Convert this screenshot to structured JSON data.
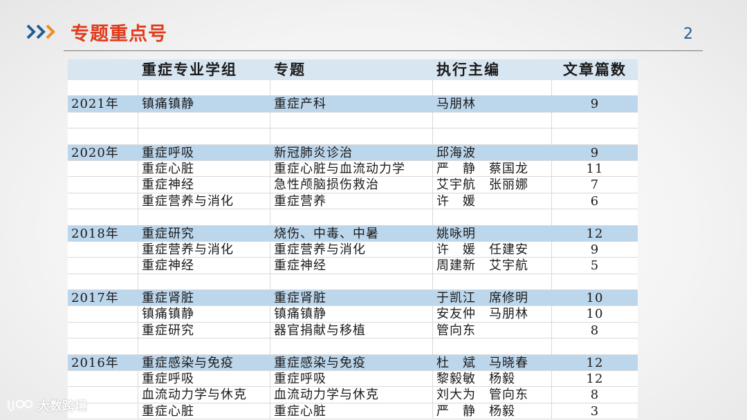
{
  "slide": {
    "title": "专题重点号",
    "page_number": "2"
  },
  "colors": {
    "title": "#e03b1c",
    "chevron_blue": "#1f5d97",
    "chevron_orange": "#f08a24",
    "header_row": "#d8e6f2",
    "year_row": "#bcd6ec"
  },
  "table": {
    "headers": [
      "",
      "重症专业学组",
      "专题",
      "执行主编",
      "文章篇数"
    ],
    "rows": [
      {
        "type": "blank",
        "cells": [
          "",
          "",
          "",
          "",
          ""
        ]
      },
      {
        "type": "year",
        "cells": [
          "2021年",
          "镇痛镇静",
          "重症产科",
          "马朋林",
          "9"
        ]
      },
      {
        "type": "blank",
        "cells": [
          "",
          "",
          "",
          "",
          ""
        ]
      },
      {
        "type": "blank",
        "cells": [
          "",
          "",
          "",
          "",
          ""
        ]
      },
      {
        "type": "year",
        "cells": [
          "2020年",
          "重症呼吸",
          "新冠肺炎诊治",
          "邱海波",
          "9"
        ]
      },
      {
        "type": "data",
        "cells": [
          "",
          "重症心脏",
          "重症心脏与血流动力学",
          "严　静　蔡国龙",
          "11"
        ]
      },
      {
        "type": "data",
        "cells": [
          "",
          "重症神经",
          "急性颅脑损伤救治",
          "艾宇航　张丽娜",
          "7"
        ]
      },
      {
        "type": "data",
        "cells": [
          "",
          "重症营养与消化",
          "重症营养",
          "许　媛",
          "6"
        ]
      },
      {
        "type": "blank",
        "cells": [
          "",
          "",
          "",
          "",
          ""
        ]
      },
      {
        "type": "year",
        "cells": [
          "2018年",
          "重症研究",
          "烧伤、中毒、中暑",
          "姚咏明",
          "12"
        ]
      },
      {
        "type": "data",
        "cells": [
          "",
          "重症营养与消化",
          "重症营养与消化",
          "许　媛　任建安",
          "9"
        ]
      },
      {
        "type": "data",
        "cells": [
          "",
          "重症神经",
          "重症神经",
          "周建新　艾宇航",
          "5"
        ]
      },
      {
        "type": "blank",
        "cells": [
          "",
          "",
          "",
          "",
          ""
        ]
      },
      {
        "type": "year",
        "cells": [
          "2017年",
          "重症肾脏",
          "重症肾脏",
          "于凯江　席修明",
          "10"
        ]
      },
      {
        "type": "data",
        "cells": [
          "",
          "镇痛镇静",
          "镇痛镇静",
          "安友仲　马朋林",
          "10"
        ]
      },
      {
        "type": "data",
        "cells": [
          "",
          "重症研究",
          "器官捐献与移植",
          "管向东",
          "8"
        ]
      },
      {
        "type": "blank",
        "cells": [
          "",
          "",
          "",
          "",
          ""
        ]
      },
      {
        "type": "year",
        "cells": [
          "2016年",
          "重症感染与免疫",
          "重症感染与免疫",
          "杜　斌　马晓春",
          "12"
        ]
      },
      {
        "type": "data",
        "cells": [
          "",
          "重症呼吸",
          "重症呼吸",
          "黎毅敏　杨毅",
          "12"
        ]
      },
      {
        "type": "data",
        "cells": [
          "",
          "血流动力学与休克",
          "血流动力学与休克",
          "刘大为　管向东",
          "8"
        ]
      },
      {
        "type": "data",
        "cells": [
          "",
          "重症心脏",
          "重症心脏",
          "严　静　杨毅",
          "3"
        ]
      }
    ]
  },
  "watermark": {
    "text": "大数跨境",
    "icon": "dashuju-logo-icon"
  }
}
